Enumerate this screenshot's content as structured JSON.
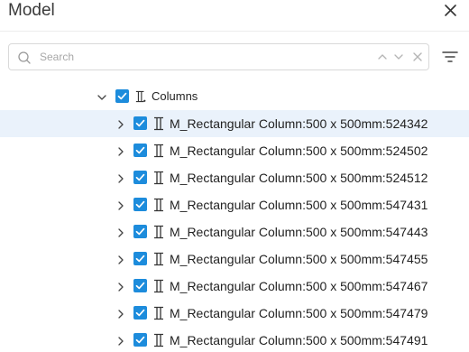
{
  "panel": {
    "title": "Model"
  },
  "search": {
    "placeholder": "Search",
    "value": ""
  },
  "tree": {
    "parent": {
      "label": "Columns",
      "checked": true,
      "expanded": true
    },
    "children": [
      {
        "label": "M_Rectangular Column:500 x 500mm:524342",
        "checked": true,
        "selected": true
      },
      {
        "label": "M_Rectangular Column:500 x 500mm:524502",
        "checked": true,
        "selected": false
      },
      {
        "label": "M_Rectangular Column:500 x 500mm:524512",
        "checked": true,
        "selected": false
      },
      {
        "label": "M_Rectangular Column:500 x 500mm:547431",
        "checked": true,
        "selected": false
      },
      {
        "label": "M_Rectangular Column:500 x 500mm:547443",
        "checked": true,
        "selected": false
      },
      {
        "label": "M_Rectangular Column:500 x 500mm:547455",
        "checked": true,
        "selected": false
      },
      {
        "label": "M_Rectangular Column:500 x 500mm:547467",
        "checked": true,
        "selected": false
      },
      {
        "label": "M_Rectangular Column:500 x 500mm:547479",
        "checked": true,
        "selected": false
      },
      {
        "label": "M_Rectangular Column:500 x 500mm:547491",
        "checked": true,
        "selected": false
      }
    ]
  },
  "icons": {
    "close": "close-icon",
    "search": "search-icon",
    "prev": "chevron-up-icon",
    "next": "chevron-down-icon",
    "clear": "clear-icon",
    "filter": "filter-icon",
    "expand": "chevron-right-icon",
    "collapse": "chevron-down-icon",
    "checkbox": "checkbox-checked-icon",
    "column": "column-icon"
  },
  "colors": {
    "accent": "#1d8cdc",
    "selected_row": "#eaf2fb",
    "text": "#222222",
    "muted": "#a8a8a8"
  }
}
